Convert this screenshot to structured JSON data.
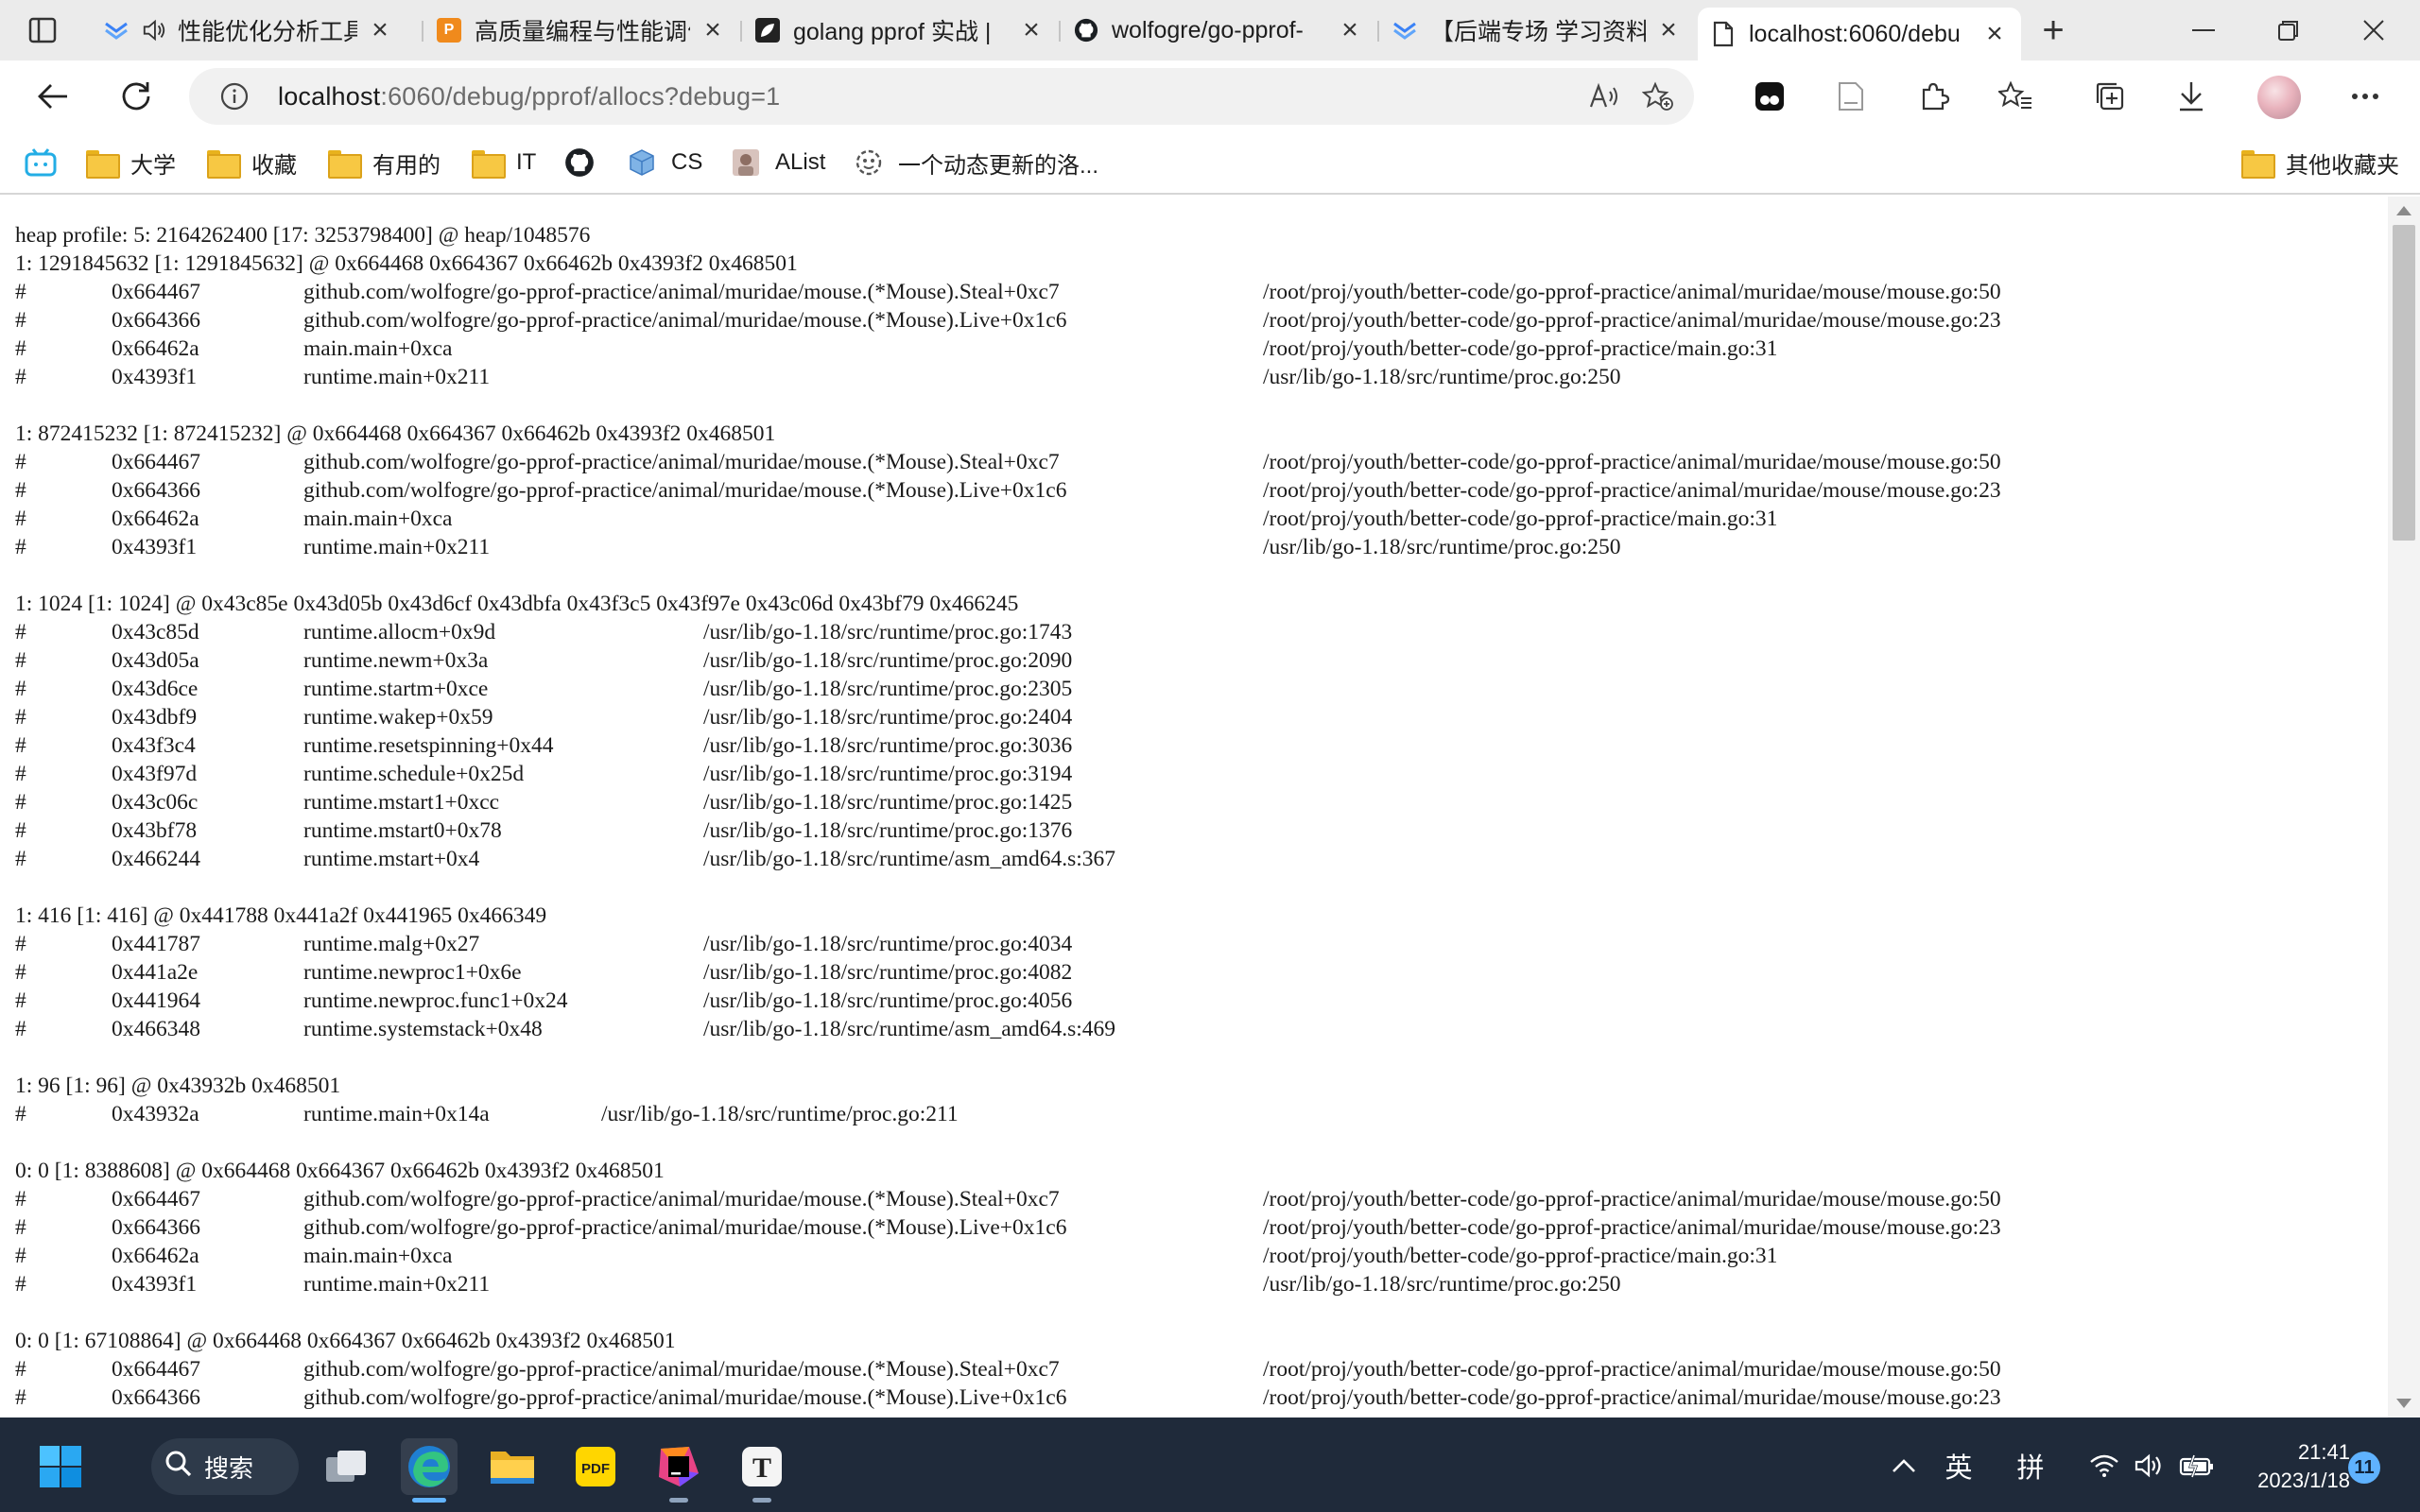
{
  "tabs": [
    {
      "title": "性能优化分析工具",
      "favicon": "blue-chevron-icon",
      "muted": true,
      "active": false
    },
    {
      "title": "高质量编程与性能调优",
      "favicon": "orange-p-icon",
      "active": false
    },
    {
      "title": "golang pprof 实战 |",
      "favicon": "dark-leaf-icon",
      "active": false
    },
    {
      "title": "wolfogre/go-pprof-",
      "favicon": "github-icon",
      "active": false
    },
    {
      "title": "【后端专场 学习资料",
      "favicon": "blue-chevron-icon",
      "active": false
    },
    {
      "title": "localhost:6060/debu",
      "favicon": "page-icon",
      "active": true
    }
  ],
  "address": {
    "host": "localhost",
    "rest": ":6060/debug/pprof/allocs?debug=1"
  },
  "bookmarks": [
    {
      "label": "",
      "icon": "bilibili-icon"
    },
    {
      "label": "大学",
      "icon": "folder-icon"
    },
    {
      "label": "收藏",
      "icon": "folder-icon"
    },
    {
      "label": "有用的",
      "icon": "folder-icon"
    },
    {
      "label": "IT",
      "icon": "folder-icon"
    },
    {
      "label": "",
      "icon": "github-icon"
    },
    {
      "label": "CS",
      "icon": "cube-icon"
    },
    {
      "label": "AList",
      "icon": "alist-icon"
    },
    {
      "label": "一个动态更新的洛...",
      "icon": "gear-face-icon"
    }
  ],
  "other_bookmarks": "其他收藏夹",
  "profile": {
    "lines": [
      [
        "heap profile: 5: 2164262400 [17: 3253798400] @ heap/1048576"
      ],
      [
        "1: 1291845632 [1: 1291845632] @ 0x664468 0x664367 0x66462b 0x4393f2 0x468501"
      ],
      [
        "#",
        "0x664467",
        "github.com/wolfogre/go-pprof-practice/animal/muridae/mouse.(*Mouse).Steal+0xc7",
        "/root/proj/youth/better-code/go-pprof-practice/animal/muridae/mouse/mouse.go:50"
      ],
      [
        "#",
        "0x664366",
        "github.com/wolfogre/go-pprof-practice/animal/muridae/mouse.(*Mouse).Live+0x1c6",
        "/root/proj/youth/better-code/go-pprof-practice/animal/muridae/mouse/mouse.go:23"
      ],
      [
        "#",
        "0x66462a",
        "main.main+0xca",
        "/root/proj/youth/better-code/go-pprof-practice/main.go:31"
      ],
      [
        "#",
        "0x4393f1",
        "runtime.main+0x211",
        "/usr/lib/go-1.18/src/runtime/proc.go:250"
      ],
      [
        ""
      ],
      [
        "1: 872415232 [1: 872415232] @ 0x664468 0x664367 0x66462b 0x4393f2 0x468501"
      ],
      [
        "#",
        "0x664467",
        "github.com/wolfogre/go-pprof-practice/animal/muridae/mouse.(*Mouse).Steal+0xc7",
        "/root/proj/youth/better-code/go-pprof-practice/animal/muridae/mouse/mouse.go:50"
      ],
      [
        "#",
        "0x664366",
        "github.com/wolfogre/go-pprof-practice/animal/muridae/mouse.(*Mouse).Live+0x1c6",
        "/root/proj/youth/better-code/go-pprof-practice/animal/muridae/mouse/mouse.go:23"
      ],
      [
        "#",
        "0x66462a",
        "main.main+0xca",
        "/root/proj/youth/better-code/go-pprof-practice/main.go:31"
      ],
      [
        "#",
        "0x4393f1",
        "runtime.main+0x211",
        "/usr/lib/go-1.18/src/runtime/proc.go:250"
      ],
      [
        ""
      ],
      [
        "1: 1024 [1: 1024] @ 0x43c85e 0x43d05b 0x43d6cf 0x43dbfa 0x43f3c5 0x43f97e 0x43c06d 0x43bf79 0x466245"
      ],
      [
        "#",
        "0x43c85d",
        "runtime.allocm+0x9d",
        "/usr/lib/go-1.18/src/runtime/proc.go:1743"
      ],
      [
        "#",
        "0x43d05a",
        "runtime.newm+0x3a",
        "/usr/lib/go-1.18/src/runtime/proc.go:2090"
      ],
      [
        "#",
        "0x43d6ce",
        "runtime.startm+0xce",
        "/usr/lib/go-1.18/src/runtime/proc.go:2305"
      ],
      [
        "#",
        "0x43dbf9",
        "runtime.wakep+0x59",
        "/usr/lib/go-1.18/src/runtime/proc.go:2404"
      ],
      [
        "#",
        "0x43f3c4",
        "runtime.resetspinning+0x44",
        "/usr/lib/go-1.18/src/runtime/proc.go:3036"
      ],
      [
        "#",
        "0x43f97d",
        "runtime.schedule+0x25d",
        "/usr/lib/go-1.18/src/runtime/proc.go:3194"
      ],
      [
        "#",
        "0x43c06c",
        "runtime.mstart1+0xcc",
        "/usr/lib/go-1.18/src/runtime/proc.go:1425"
      ],
      [
        "#",
        "0x43bf78",
        "runtime.mstart0+0x78",
        "/usr/lib/go-1.18/src/runtime/proc.go:1376"
      ],
      [
        "#",
        "0x466244",
        "runtime.mstart+0x4",
        "/usr/lib/go-1.18/src/runtime/asm_amd64.s:367"
      ],
      [
        ""
      ],
      [
        "1: 416 [1: 416] @ 0x441788 0x441a2f 0x441965 0x466349"
      ],
      [
        "#",
        "0x441787",
        "runtime.malg+0x27",
        "/usr/lib/go-1.18/src/runtime/proc.go:4034"
      ],
      [
        "#",
        "0x441a2e",
        "runtime.newproc1+0x6e",
        "/usr/lib/go-1.18/src/runtime/proc.go:4082"
      ],
      [
        "#",
        "0x441964",
        "runtime.newproc.func1+0x24",
        "/usr/lib/go-1.18/src/runtime/proc.go:4056"
      ],
      [
        "#",
        "0x466348",
        "runtime.systemstack+0x48",
        "/usr/lib/go-1.18/src/runtime/asm_amd64.s:469"
      ],
      [
        ""
      ],
      [
        "1: 96 [1: 96] @ 0x43932b 0x468501"
      ],
      [
        "#",
        "0x43932a",
        "runtime.main+0x14a",
        "/usr/lib/go-1.18/src/runtime/proc.go:211"
      ],
      [
        ""
      ],
      [
        "0: 0 [1: 8388608] @ 0x664468 0x664367 0x66462b 0x4393f2 0x468501"
      ],
      [
        "#",
        "0x664467",
        "github.com/wolfogre/go-pprof-practice/animal/muridae/mouse.(*Mouse).Steal+0xc7",
        "/root/proj/youth/better-code/go-pprof-practice/animal/muridae/mouse/mouse.go:50"
      ],
      [
        "#",
        "0x664366",
        "github.com/wolfogre/go-pprof-practice/animal/muridae/mouse.(*Mouse).Live+0x1c6",
        "/root/proj/youth/better-code/go-pprof-practice/animal/muridae/mouse/mouse.go:23"
      ],
      [
        "#",
        "0x66462a",
        "main.main+0xca",
        "/root/proj/youth/better-code/go-pprof-practice/main.go:31"
      ],
      [
        "#",
        "0x4393f1",
        "runtime.main+0x211",
        "/usr/lib/go-1.18/src/runtime/proc.go:250"
      ],
      [
        ""
      ],
      [
        "0: 0 [1: 67108864] @ 0x664468 0x664367 0x66462b 0x4393f2 0x468501"
      ],
      [
        "#",
        "0x664467",
        "github.com/wolfogre/go-pprof-practice/animal/muridae/mouse.(*Mouse).Steal+0xc7",
        "/root/proj/youth/better-code/go-pprof-practice/animal/muridae/mouse/mouse.go:50"
      ],
      [
        "#",
        "0x664366",
        "github.com/wolfogre/go-pprof-practice/animal/muridae/mouse.(*Mouse).Live+0x1c6",
        "/root/proj/youth/better-code/go-pprof-practice/animal/muridae/mouse/mouse.go:23"
      ]
    ]
  },
  "taskbar": {
    "search_label": "搜索",
    "apps": [
      "windows-start-icon",
      "search-icon",
      "task-view-icon",
      "edge-icon",
      "file-explorer-icon",
      "pdf-icon",
      "jetbrains-icon",
      "typora-icon"
    ],
    "ime_lang": "英",
    "ime_mode": "拼",
    "time": "21:41",
    "date": "2023/1/18",
    "notifications": "11"
  }
}
